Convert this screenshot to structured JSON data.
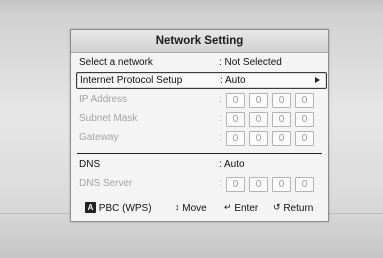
{
  "title": "Network Setting",
  "rows": [
    {
      "label": "Select a network",
      "value": ": Not Selected"
    },
    {
      "label": "Internet Protocol Setup",
      "value": ": Auto"
    },
    {
      "label": "IP Address"
    },
    {
      "label": "Subnet Mask"
    },
    {
      "label": "Gateway"
    },
    {
      "label": "DNS",
      "value": ": Auto"
    },
    {
      "label": "DNS Server"
    }
  ],
  "colon": ":",
  "octet_value": "0",
  "footer": {
    "pbc_key": "A",
    "pbc_label": "PBC (WPS)",
    "move_icon": "up-down-arrows-icon",
    "move_label": "Move",
    "enter_icon": "enter-icon",
    "enter_label": "Enter",
    "return_icon": "return-icon",
    "return_label": "Return"
  },
  "colors": {
    "panel_bg": "#f4f4f4",
    "text": "#111111",
    "dim_text": "#a3a3a3",
    "selection_border": "#3a3a3a"
  }
}
